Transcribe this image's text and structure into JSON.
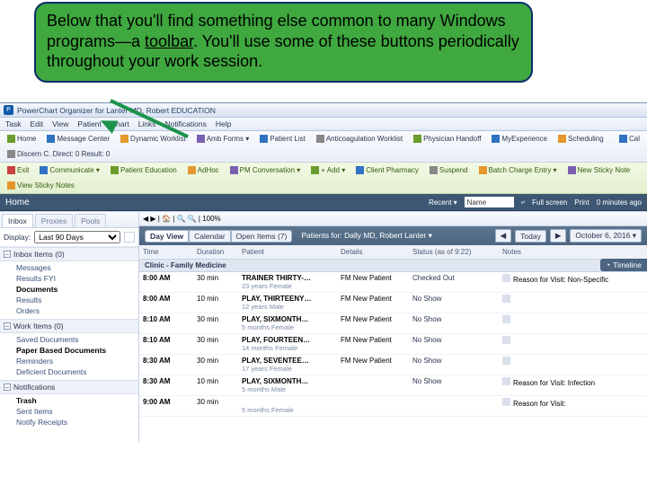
{
  "callout_text_a": "Below that you'll find something else common to many Windows programs—a ",
  "callout_text_tool": "toolbar",
  "callout_text_b": ".  You'll use some of these buttons periodically throughout your work session.",
  "titlebar": {
    "icon_label": "P",
    "title": "PowerChart Organizer for Lanter MD, Robert EDUCATION"
  },
  "menu": [
    "Task",
    "Edit",
    "View",
    "Patient",
    "Chart",
    "Links",
    "Notifications",
    "Help"
  ],
  "toolbar1": [
    {
      "icon": "ic-sq",
      "label": "Home"
    },
    {
      "icon": "ic-bl",
      "label": "Message Center"
    },
    {
      "icon": "ic-or",
      "label": "Dynamic Worklist"
    },
    {
      "icon": "ic-pu",
      "label": "Amb Forms ▾"
    },
    {
      "icon": "ic-bl",
      "label": "Patient List"
    },
    {
      "icon": "ic-gr",
      "label": "Anticoagulation Worklist"
    },
    {
      "icon": "ic-sq",
      "label": "Physician Handoff"
    },
    {
      "icon": "ic-bl",
      "label": "MyExperience"
    },
    {
      "icon": "ic-or",
      "label": "Scheduling"
    }
  ],
  "toolbar_right": [
    {
      "icon": "ic-bl",
      "label": "Cal"
    },
    {
      "icon": "ic-gr",
      "label": "Discern C. Direct: 0  Result: 0"
    }
  ],
  "toolbar2": [
    {
      "icon": "ic-rd",
      "label": "Exit"
    },
    {
      "icon": "ic-bl",
      "label": "Communicate ▾"
    },
    {
      "icon": "ic-sq",
      "label": "Patient Education"
    },
    {
      "icon": "ic-or",
      "label": "AdHoc"
    },
    {
      "icon": "ic-pu",
      "label": "PM Conversation ▾"
    },
    {
      "icon": "ic-sq",
      "label": "+ Add ▾"
    },
    {
      "icon": "ic-bl",
      "label": "Client Pharmacy"
    },
    {
      "icon": "ic-gr",
      "label": "Suspend"
    },
    {
      "icon": "ic-or",
      "label": "Batch Charge Entry ▾"
    },
    {
      "icon": "ic-pu",
      "label": "New Sticky Note"
    },
    {
      "icon": "ic-or",
      "label": "View Sticky Notes"
    }
  ],
  "header": {
    "title": "Home",
    "recent_label": "Recent ▾",
    "name_label": "Name",
    "fullscreen": "Full screen",
    "print": "Print",
    "ago": "0 minutes ago"
  },
  "side": {
    "tabs": [
      "Inbox",
      "Proxies",
      "Pools"
    ],
    "display_label": "Display:",
    "display_value": "Last 90 Days",
    "sections": [
      {
        "title": "Inbox Items (0)",
        "items": [
          {
            "label": "Messages"
          },
          {
            "label": "Results FYI"
          },
          {
            "label": "Documents",
            "bold": true
          },
          {
            "label": "Results"
          },
          {
            "label": "Orders"
          }
        ]
      },
      {
        "title": "Work Items (0)",
        "items": [
          {
            "label": "Saved Documents"
          },
          {
            "label": "Paper Based Documents",
            "bold": true
          },
          {
            "label": "Reminders"
          },
          {
            "label": "Deficient Documents"
          }
        ]
      },
      {
        "title": "Notifications",
        "items": [
          {
            "label": "Trash",
            "bold": true
          },
          {
            "label": "Sent Items"
          },
          {
            "label": "Notify Receipts"
          }
        ]
      }
    ]
  },
  "main": {
    "top_icons": "◀ ▶ | 🏠 | 🔍 🔍 | 100%",
    "segments": [
      "Day View",
      "Calendar",
      "Open Items (7)"
    ],
    "patients_for": "Patients for: Dally MD, Robert Lanter ▾",
    "nav": [
      "◀",
      "Today",
      "▶",
      "October 6, 2016 ▾"
    ],
    "columns": [
      "Time",
      "Duration",
      "Patient",
      "Details",
      "Status (as of 9:22)",
      "Notes"
    ],
    "timeline": "Timeline",
    "group": "Clinic - Family Medicine",
    "rows": [
      {
        "time": "8:00 AM",
        "dur": "30 min",
        "pat": "TRAINER THIRTY-…",
        "sub": "23 years  Female",
        "det": "FM New Patient",
        "stat": "Checked Out",
        "note": "Reason for Visit: Non-Specific"
      },
      {
        "time": "8:00 AM",
        "dur": "10 min",
        "pat": "PLAY, THIRTEENY…",
        "sub": "12 years  Male",
        "det": "FM New Patient",
        "stat": "No Show",
        "note": ""
      },
      {
        "time": "8:10 AM",
        "dur": "30 min",
        "pat": "PLAY, SIXMONTH…",
        "sub": "5 months  Female",
        "det": "FM New Patient",
        "stat": "No Show",
        "note": ""
      },
      {
        "time": "8:10 AM",
        "dur": "30 min",
        "pat": "PLAY, FOURTEEN…",
        "sub": "14 months  Female",
        "det": "FM New Patient",
        "stat": "No Show",
        "note": ""
      },
      {
        "time": "8:30 AM",
        "dur": "30 min",
        "pat": "PLAY, SEVENTEE…",
        "sub": "17 years  Female",
        "det": "FM New Patient",
        "stat": "No Show",
        "note": ""
      },
      {
        "time": "8:30 AM",
        "dur": "10 min",
        "pat": "PLAY, SIXMONTH…",
        "sub": "5 months  Male",
        "det": "",
        "stat": "No Show",
        "note": "Reason for Visit: Infection"
      },
      {
        "time": "9:00 AM",
        "dur": "30 min",
        "pat": "",
        "sub": "5 months  Female",
        "det": "",
        "stat": "",
        "note": "Reason for Visit:"
      }
    ]
  }
}
